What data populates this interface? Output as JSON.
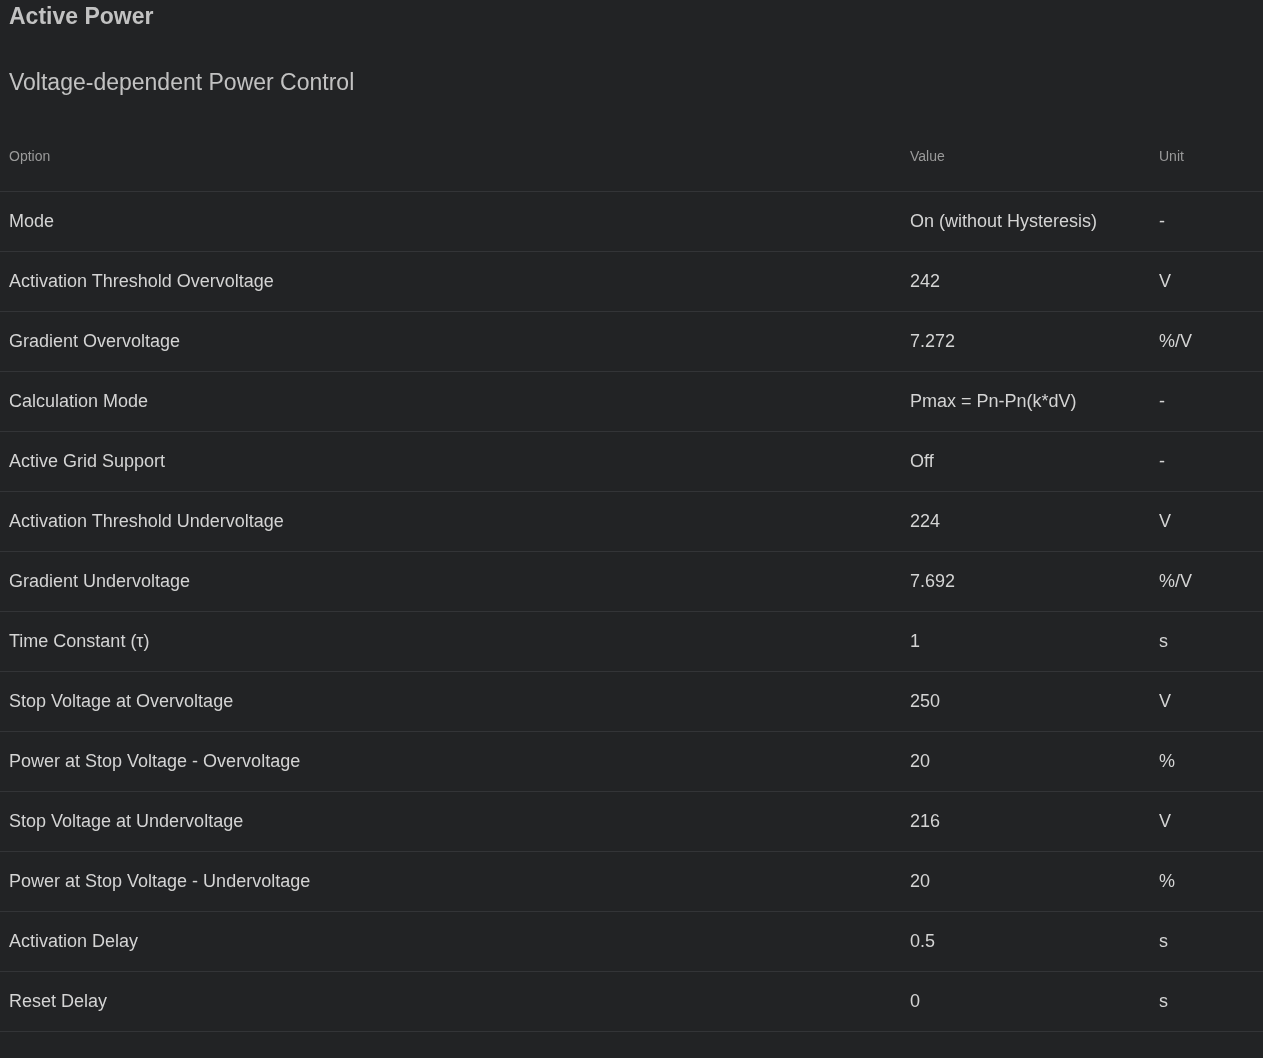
{
  "title": "Active Power",
  "subtitle": "Voltage-dependent Power Control",
  "table": {
    "columns": [
      "Option",
      "Value",
      "Unit"
    ],
    "rows": [
      {
        "option": "Mode",
        "value": "On (without Hysteresis)",
        "unit": "-"
      },
      {
        "option": "Activation Threshold Overvoltage",
        "value": "242",
        "unit": "V"
      },
      {
        "option": "Gradient Overvoltage",
        "value": "7.272",
        "unit": "%/V"
      },
      {
        "option": "Calculation Mode",
        "value": "Pmax = Pn-Pn(k*dV)",
        "unit": "-"
      },
      {
        "option": "Active Grid Support",
        "value": "Off",
        "unit": "-"
      },
      {
        "option": "Activation Threshold Undervoltage",
        "value": "224",
        "unit": "V"
      },
      {
        "option": "Gradient Undervoltage",
        "value": "7.692",
        "unit": "%/V"
      },
      {
        "option": "Time Constant (τ)",
        "value": "1",
        "unit": "s"
      },
      {
        "option": "Stop Voltage at Overvoltage",
        "value": "250",
        "unit": "V"
      },
      {
        "option": "Power at Stop Voltage - Overvoltage",
        "value": "20",
        "unit": "%"
      },
      {
        "option": "Stop Voltage at Undervoltage",
        "value": "216",
        "unit": "V"
      },
      {
        "option": "Power at Stop Voltage - Undervoltage",
        "value": "20",
        "unit": "%"
      },
      {
        "option": "Activation Delay",
        "value": "0.5",
        "unit": "s"
      },
      {
        "option": "Reset Delay",
        "value": "0",
        "unit": "s"
      }
    ]
  }
}
